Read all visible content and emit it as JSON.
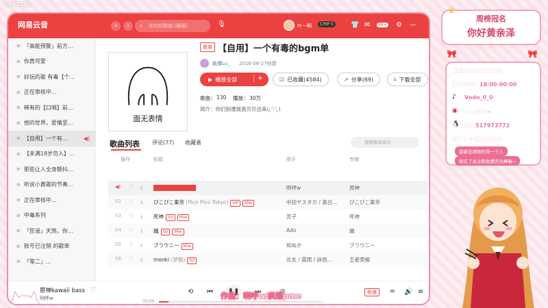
{
  "app": {
    "logo": "网易云音",
    "search_placeholder": "坎坎的歌曲 [暖暖]",
    "username": "叶一啊",
    "vip": "CHIP 5",
    "badge_count": "99+",
    "watermark": "3631543"
  },
  "sidebar": {
    "items": [
      {
        "label": "「高能预警」前方..."
      },
      {
        "label": "你真可爱"
      },
      {
        "label": "好玩的歌 有毒【个..."
      },
      {
        "label": "正在审核中..."
      },
      {
        "label": "稀有的【口哨】前..."
      },
      {
        "label": "他的世界，爱情至..."
      },
      {
        "label": "【自用】一个有..."
      },
      {
        "label": "【未满18岁勿入】..."
      },
      {
        "label": "那些让人全身颤抖..."
      },
      {
        "label": "听说小黄歌的节奏..."
      },
      {
        "label": "正在审核中..."
      },
      {
        "label": "中毒系列"
      },
      {
        "label": "「民谣」天煞，你..."
      },
      {
        "label": "账号已注销 的歌单"
      },
      {
        "label": "「零二」..."
      }
    ]
  },
  "playlist": {
    "tag": "歌单",
    "title": "【自用】一个有毒的bgm单",
    "creator": "疯爆Lu_",
    "created": "2016-08-27创建",
    "play_all": "播放全部",
    "collected": "已收藏(4584)",
    "share": "分享(69)",
    "download": "下载全部",
    "songs_label": "歌曲：",
    "songs_count": "130",
    "plays_label": "播放：",
    "plays_count": "30万",
    "intro": "简介：你们别遭我我贝贝出来(｡'-'｡)",
    "cover_text": "面无表情"
  },
  "tabs": {
    "songs": "歌曲列表",
    "comments": "评论(77)",
    "collectors": "收藏者",
    "search_placeholder": "搜索歌单音乐"
  },
  "table": {
    "headers": {
      "ops": "操作",
      "title": "标题",
      "artist": "歌手",
      "album": "专辑"
    },
    "rows": [
      {
        "num": "",
        "title": "原神kawaii bass",
        "tags": "",
        "artist": "咧呼w",
        "album": "原神"
      },
      {
        "num": "02",
        "title": "ぴこぴこ東京",
        "sub": "(Pico Pico Tokyo)",
        "tags": "VIP MV",
        "artist": "中田ヤスタカ / 真白...",
        "album": "ぴこぴこ東京"
      },
      {
        "num": "03",
        "title": "死神",
        "tags": "SQ MV",
        "artist": "苦子",
        "album": "死神"
      },
      {
        "num": "04",
        "title": "踊",
        "tags": "SQ MV",
        "artist": "Ado",
        "album": "踊"
      },
      {
        "num": "05",
        "title": "ブラウニー",
        "tags": "MV",
        "artist": "和ぬか",
        "album": "ブラウニー"
      },
      {
        "num": "06",
        "title": "monki",
        "sub": "(梦猴)",
        "tags": "SQ",
        "artist": "北玄 / 晨雨 / 詳西...",
        "album": "王者荣耀"
      }
    ]
  },
  "player": {
    "title": "原神kawaii bass",
    "artist": "咧呼w",
    "time_current": "00:04",
    "progress": 0.06,
    "quality": "极速",
    "credit": "作曲：咧呼w/疯爆pme"
  },
  "overlay": {
    "rank_title": "周榜冠名",
    "greeting": "你好黄亲泽",
    "lines": [
      "三级粉丝牌进营信群",
      "直播时间：18:00-00:00",
      "Vodo_0_0",
      "小小丸叮~",
      "群：517973772",
      "房管：十五级粉丝牌"
    ],
    "pills": [
      "最新吉祥物的哥一个人",
      "刚忘了关注和免费荧光棒嘛~"
    ]
  },
  "colors": {
    "accent": "#ec4141",
    "pink": "#f3a6b9",
    "text_pink": "#e7557a"
  }
}
